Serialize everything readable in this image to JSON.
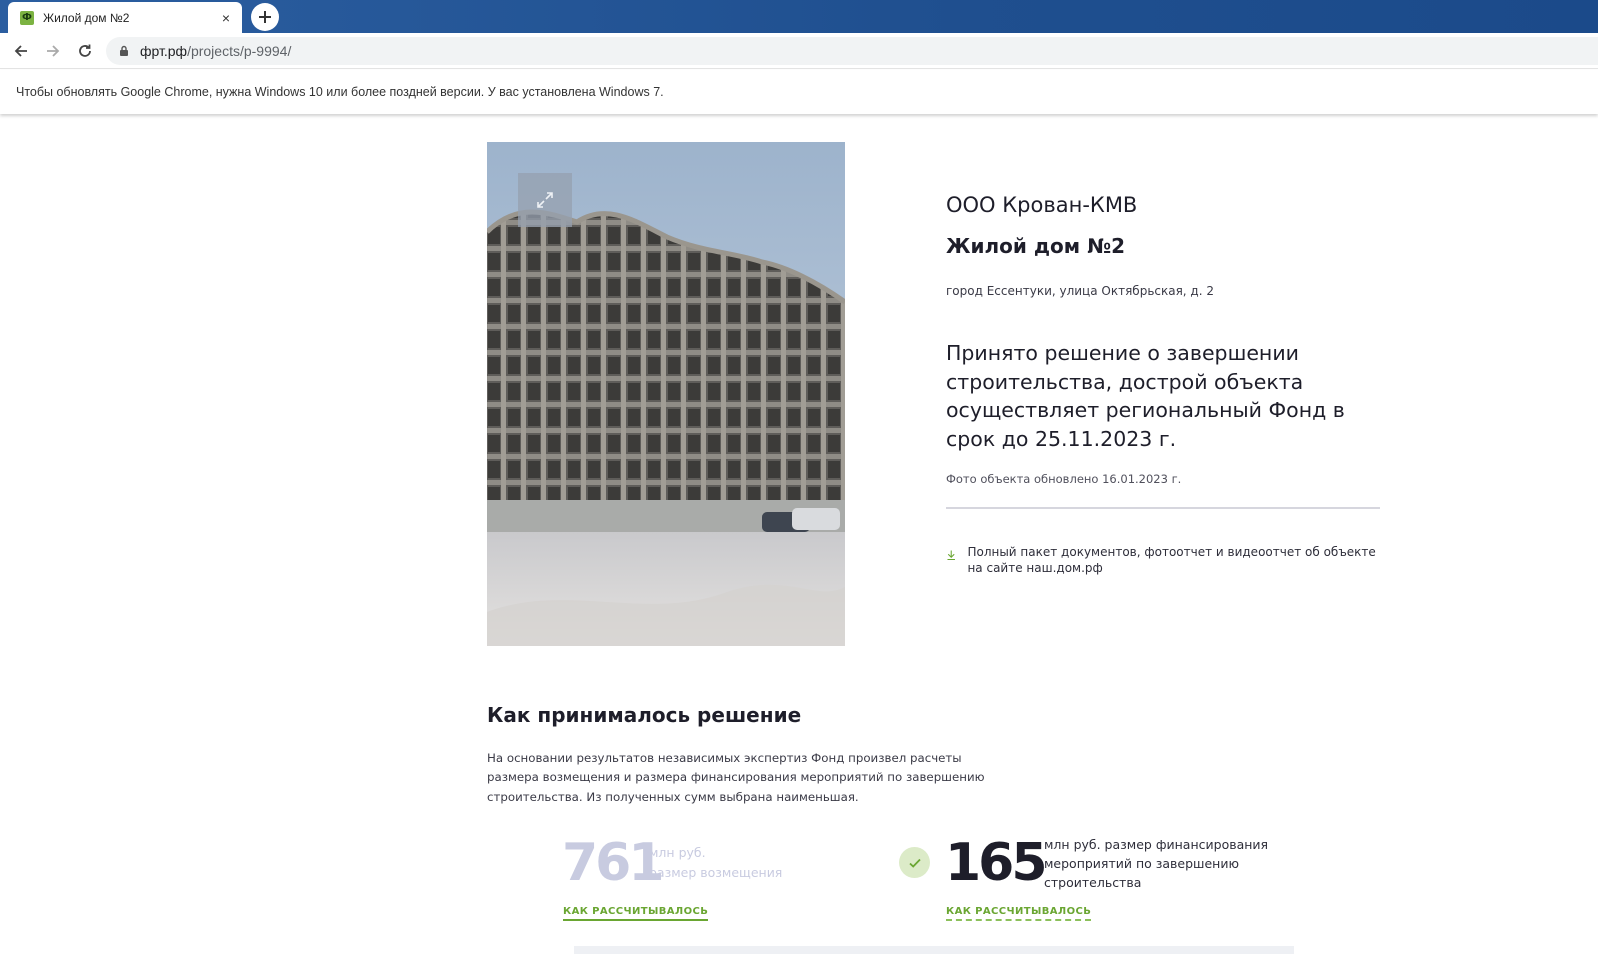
{
  "browser": {
    "tab_title": "Жилой дом №2",
    "favicon_letter": "Ф",
    "close_glyph": "×",
    "url_host": "фрт.рф",
    "url_path": "/projects/p-9994/",
    "infobar_text": "Чтобы обновлять Google Chrome, нужна Windows 10 или более поздней версии. У вас установлена Windows 7."
  },
  "project": {
    "company": "ООО Крован-КМВ",
    "object_name": "Жилой дом №2",
    "address": "город Ессентуки, улица Октябрьская, д. 2",
    "decision": "Принято решение о завершении строительства, дострой объекта осуществляет региональный Фонд в срок до 25.11.2023 г.",
    "photo_updated": "Фото объекта обновлено 16.01.2023 г.",
    "docs_link": "Полный пакет документов, фотоотчет и видеоотчет об объекте на сайте наш.дом.рф"
  },
  "decision_section": {
    "title": "Как принималось решение",
    "text": "На основании результатов независимых экспертиз Фонд произвел расчеты размера возмещения и размера финансирования мероприятий по завершению строительства. Из полученных сумм выбрана наименьшая.",
    "compensation": {
      "value": "761",
      "unit_line1": "млн руб.",
      "unit_line2": "размер возмещения",
      "link": "КАК РАССЧИТЫВАЛОСЬ"
    },
    "financing": {
      "value": "165",
      "unit": "млн руб. размер финансирования мероприятий по завершению строительства",
      "link": "КАК РАССЧИТЫВАЛОСЬ",
      "selected": true
    }
  },
  "colors": {
    "accent_green": "#6aa632",
    "muted_number": "#c8cbe0",
    "text_dark": "#1e1e2a",
    "chrome_blue": "#1f4f8f"
  },
  "icons": [
    "favicon-icon",
    "close-icon",
    "plus-icon",
    "back-arrow-icon",
    "forward-arrow-icon",
    "reload-icon",
    "lock-icon",
    "expand-icon",
    "download-icon",
    "check-icon"
  ]
}
